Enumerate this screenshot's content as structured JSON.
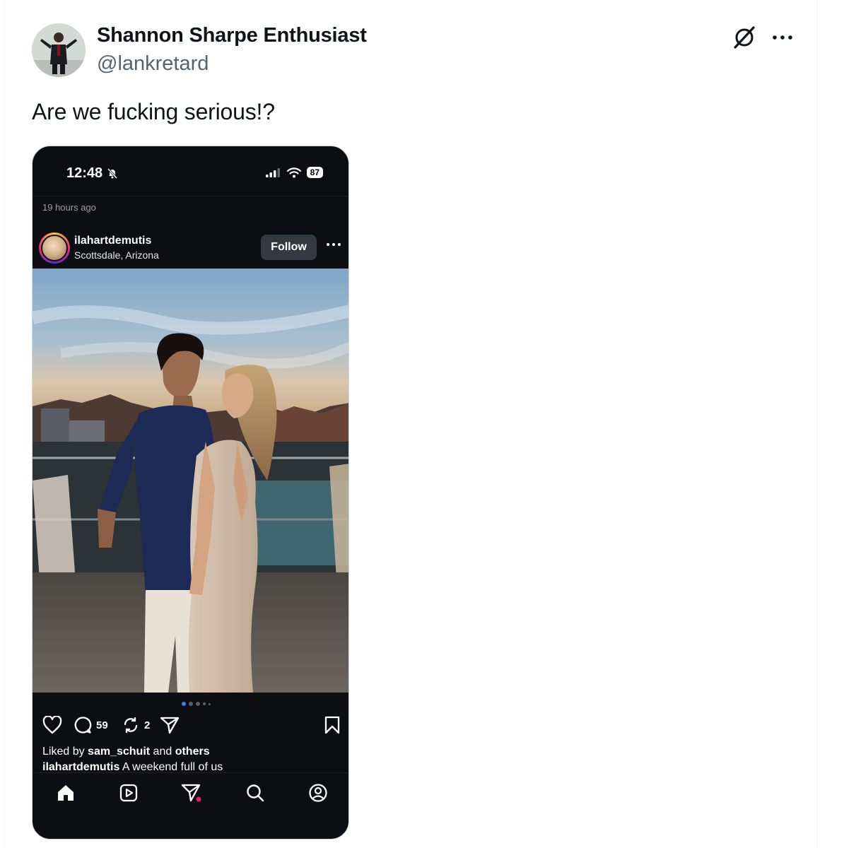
{
  "tweet": {
    "author_name": "Shannon Sharpe Enthusiast",
    "author_handle": "@lankretard",
    "text": "Are we fucking serious!?",
    "icons": [
      "grok-icon",
      "more-icon"
    ]
  },
  "embedded_screenshot": {
    "status_bar": {
      "time": "12:48",
      "battery": "87"
    },
    "post_time": "19 hours ago",
    "post_header": {
      "username": "ilahartdemutis",
      "location": "Scottsdale, Arizona",
      "follow_label": "Follow"
    },
    "carousel": {
      "current_index": 1,
      "count": 5
    },
    "actions": {
      "comments": "59",
      "reposts": "2"
    },
    "liked_by": {
      "prefix": "Liked by ",
      "user": "sam_schuit",
      "middle": " and ",
      "suffix": "others"
    },
    "caption": {
      "user": "ilahartdemutis",
      "text": " A weekend full of us"
    },
    "colors": {
      "background": "#0c0e12",
      "active_dot": "#3e7bfa",
      "notification_dot": "#e0245e"
    }
  }
}
